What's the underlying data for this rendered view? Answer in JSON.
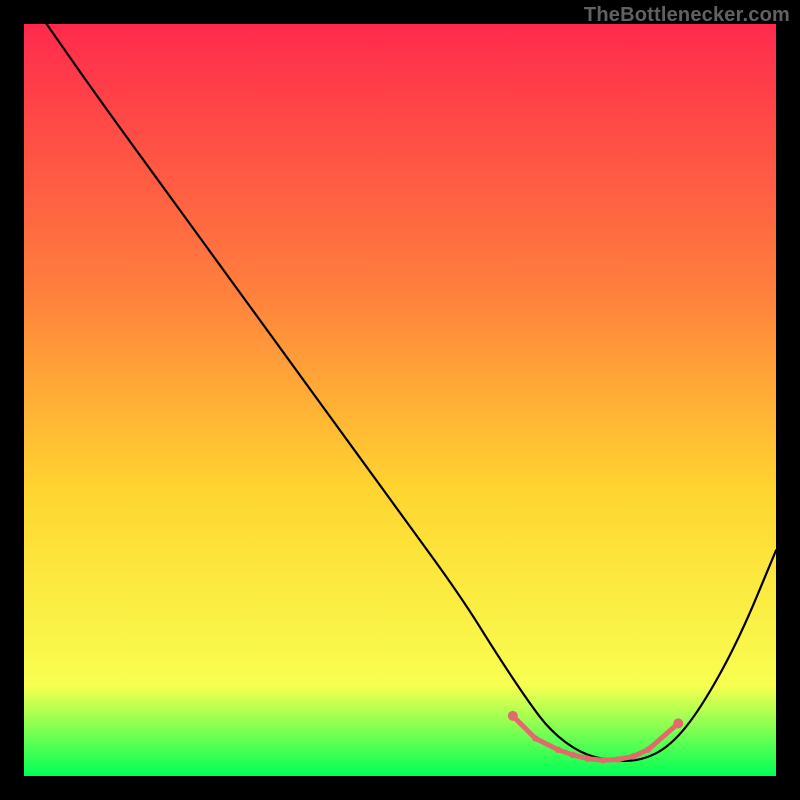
{
  "watermark": "TheBottlenecker.com",
  "chart_data": {
    "type": "line",
    "title": "",
    "xlabel": "",
    "ylabel": "",
    "xlim": [
      0,
      100
    ],
    "ylim": [
      0,
      100
    ],
    "grid": false,
    "legend": false,
    "background_gradient": {
      "top_color": "#ff2a4c",
      "mid_top_color": "#ff7e3d",
      "mid_color": "#ffd530",
      "mid_bottom_color": "#f8ff50",
      "bottom_color": "#00ff55"
    },
    "series": [
      {
        "name": "bottleneck-curve",
        "stroke": "#000000",
        "x": [
          3,
          10,
          18,
          26,
          34,
          42,
          50,
          58,
          63,
          67,
          70,
          74,
          78,
          82,
          86,
          90,
          95,
          100
        ],
        "y": [
          100,
          90,
          79,
          68,
          57,
          46,
          35,
          24,
          16,
          10,
          6,
          3,
          2,
          2,
          4,
          9,
          18,
          30
        ]
      }
    ],
    "markers": {
      "name": "bottleneck-optimal-zone",
      "stroke": "#e16a6a",
      "fill": "#e16a6a",
      "points": [
        {
          "x": 65,
          "y": 8
        },
        {
          "x": 68,
          "y": 5
        },
        {
          "x": 71,
          "y": 3.5
        },
        {
          "x": 73,
          "y": 2.8
        },
        {
          "x": 75,
          "y": 2.3
        },
        {
          "x": 77,
          "y": 2.1
        },
        {
          "x": 79,
          "y": 2.2
        },
        {
          "x": 81,
          "y": 2.6
        },
        {
          "x": 83,
          "y": 3.5
        },
        {
          "x": 87,
          "y": 7
        }
      ]
    }
  }
}
